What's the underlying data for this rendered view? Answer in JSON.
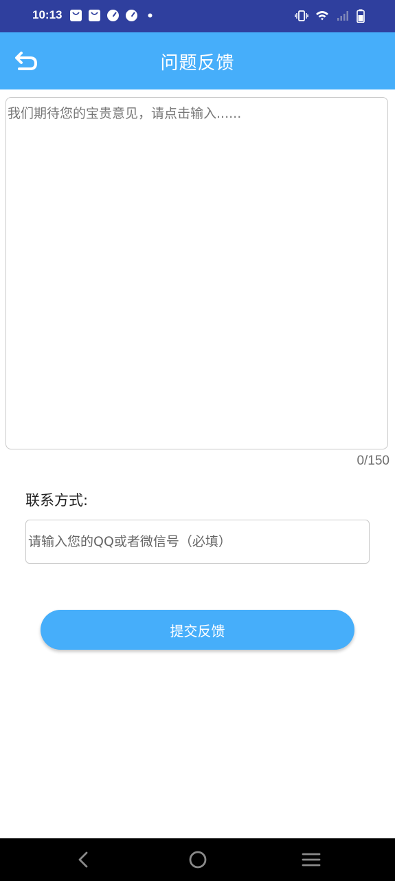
{
  "status_bar": {
    "time": "10:13",
    "notification_icons": [
      "bag-icon",
      "bag-icon",
      "speedometer-icon",
      "speedometer-icon",
      "dot-icon"
    ],
    "system_icons": [
      "vibrate-icon",
      "wifi-icon",
      "signal-icon",
      "battery-icon"
    ],
    "background": "#2f3f9e"
  },
  "toolbar": {
    "title": "问题反馈",
    "back_icon": "back-arrow-icon",
    "background": "#46aefa"
  },
  "feedback": {
    "value": "",
    "placeholder": "我们期待您的宝贵意见，请点击输入......",
    "counter": "0/150"
  },
  "contact": {
    "label": "联系方式:",
    "value": "",
    "placeholder": "请输入您的QQ或者微信号（必填）"
  },
  "submit": {
    "label": "提交反馈",
    "background": "#46aefa"
  },
  "nav_bar": {
    "icons": [
      "back-icon",
      "home-icon",
      "recents-icon"
    ]
  }
}
